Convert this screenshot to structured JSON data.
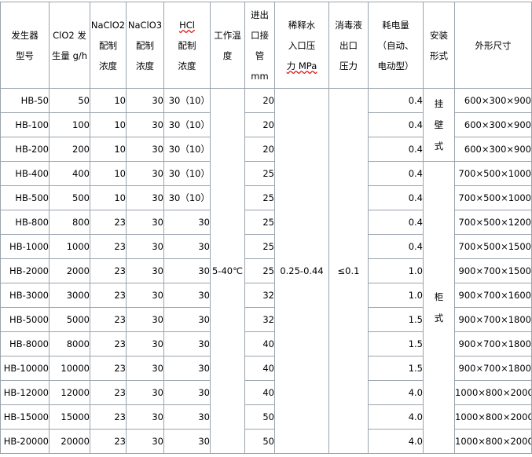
{
  "headers": {
    "model": [
      "发生器",
      "型号"
    ],
    "output": [
      "ClO2 发",
      "生量 g/h"
    ],
    "naclo2": [
      "NaClO2",
      "配制",
      "浓度"
    ],
    "naclo3": [
      "NaClO3",
      "配制",
      "浓度"
    ],
    "hcl": [
      "HCl",
      "配制",
      "浓度"
    ],
    "temp": [
      "工作温",
      "度"
    ],
    "inlet": [
      "进出",
      "口接",
      "管",
      "mm"
    ],
    "water": [
      "稀释水",
      "入口压",
      "力 MPa"
    ],
    "disinfect": [
      "消毒液",
      "出口",
      "压力"
    ],
    "power": [
      "耗电量",
      "（自动、",
      "电动型）"
    ],
    "install": [
      "安装",
      "形式"
    ],
    "dims": [
      "外形尺寸"
    ]
  },
  "merged": {
    "temp": "5-40℃",
    "water": "0.25-0.44",
    "disinfect": "≤0.1",
    "install_wall": [
      "挂",
      "壁",
      "式"
    ],
    "install_cabinet": [
      "柜",
      "式"
    ]
  },
  "rows": [
    {
      "model": "HB-50",
      "output": "50",
      "naclo2": "10",
      "naclo3": "30",
      "hcl": "30（10）",
      "inlet": "20",
      "power": "0.4",
      "dims": "600×300×900"
    },
    {
      "model": "HB-100",
      "output": "100",
      "naclo2": "10",
      "naclo3": "30",
      "hcl": "30（10）",
      "inlet": "20",
      "power": "0.4",
      "dims": "600×300×900"
    },
    {
      "model": "HB-200",
      "output": "200",
      "naclo2": "10",
      "naclo3": "30",
      "hcl": "30（10）",
      "inlet": "20",
      "power": "0.4",
      "dims": "600×300×900"
    },
    {
      "model": "HB-400",
      "output": "400",
      "naclo2": "10",
      "naclo3": "30",
      "hcl": "30（10）",
      "inlet": "25",
      "power": "0.4",
      "dims": "700×500×1000"
    },
    {
      "model": "HB-500",
      "output": "500",
      "naclo2": "10",
      "naclo3": "30",
      "hcl": "30（10）",
      "inlet": "25",
      "power": "0.4",
      "dims": "700×500×1000"
    },
    {
      "model": "HB-800",
      "output": "800",
      "naclo2": "23",
      "naclo3": "30",
      "hcl": "30",
      "inlet": "25",
      "power": "0.4",
      "dims": "700×500×1200"
    },
    {
      "model": "HB-1000",
      "output": "1000",
      "naclo2": "23",
      "naclo3": "30",
      "hcl": "30",
      "inlet": "25",
      "power": "0.4",
      "dims": "700×500×1500"
    },
    {
      "model": "HB-2000",
      "output": "2000",
      "naclo2": "23",
      "naclo3": "30",
      "hcl": "30",
      "inlet": "25",
      "power": "1.0",
      "dims": "900×700×1500"
    },
    {
      "model": "HB-3000",
      "output": "3000",
      "naclo2": "23",
      "naclo3": "30",
      "hcl": "30",
      "inlet": "32",
      "power": "1.0",
      "dims": "900×700×1600"
    },
    {
      "model": "HB-5000",
      "output": "5000",
      "naclo2": "23",
      "naclo3": "30",
      "hcl": "30",
      "inlet": "32",
      "power": "1.5",
      "dims": "900×700×1800"
    },
    {
      "model": "HB-8000",
      "output": "8000",
      "naclo2": "23",
      "naclo3": "30",
      "hcl": "30",
      "inlet": "40",
      "power": "1.5",
      "dims": "900×700×1800"
    },
    {
      "model": "HB-10000",
      "output": "10000",
      "naclo2": "23",
      "naclo3": "30",
      "hcl": "30",
      "inlet": "40",
      "power": "1.5",
      "dims": "900×700×1800"
    },
    {
      "model": "HB-12000",
      "output": "12000",
      "naclo2": "23",
      "naclo3": "30",
      "hcl": "30",
      "inlet": "40",
      "power": "4.0",
      "dims": "1000×800×2000"
    },
    {
      "model": "HB-15000",
      "output": "15000",
      "naclo2": "23",
      "naclo3": "30",
      "hcl": "30",
      "inlet": "50",
      "power": "4.0",
      "dims": "1000×800×2000"
    },
    {
      "model": "HB-20000",
      "output": "20000",
      "naclo2": "23",
      "naclo3": "30",
      "hcl": "30",
      "inlet": "50",
      "power": "4.0",
      "dims": "1000×800×2000"
    }
  ]
}
